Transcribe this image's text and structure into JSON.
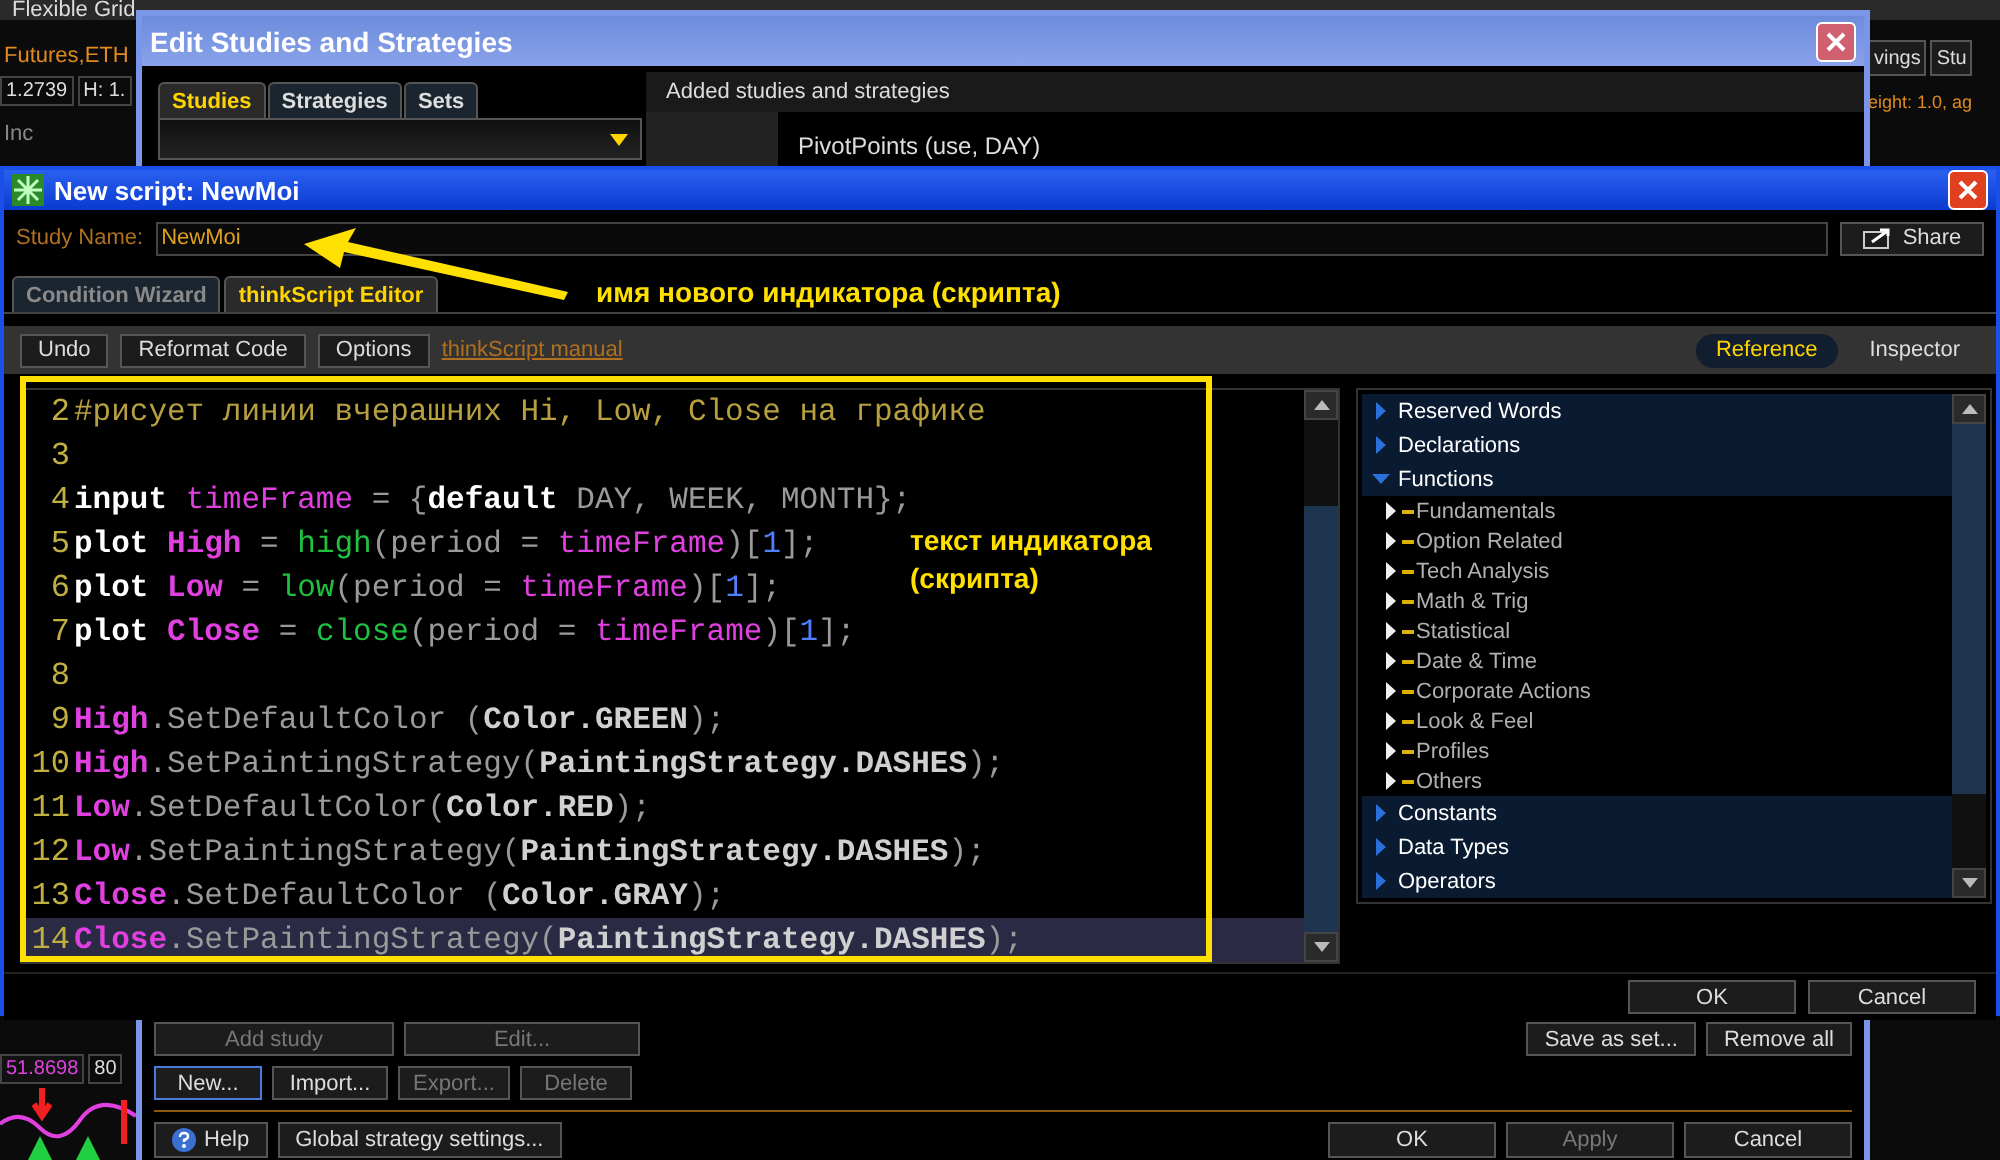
{
  "background": {
    "top_tab": "Flexible Grid",
    "symbol_text": "Futures,ETH",
    "price": "1.2739",
    "high": "H: 1.",
    "row_label": "Inc",
    "right_button": "vings",
    "study_button": "Stu",
    "right_info": "eight: 1.0, ag",
    "reading": "51.8698",
    "reading_2": "80"
  },
  "edit_studies": {
    "title": "Edit Studies and Strategies",
    "tabs": [
      {
        "label": "Studies",
        "selected": true
      },
      {
        "label": "Strategies",
        "selected": false
      },
      {
        "label": "Sets",
        "selected": false
      }
    ],
    "added_label": "Added studies and strategies",
    "added_item": "PivotPoints (use, DAY)",
    "row_1_left": [
      {
        "label": "Add study",
        "disabled": true
      },
      {
        "label": "Edit...",
        "disabled": true
      }
    ],
    "row_1_right": [
      {
        "label": "Save as set...",
        "disabled": false
      },
      {
        "label": "Remove all",
        "disabled": false
      }
    ],
    "row_2": [
      {
        "label": "New...",
        "disabled": false,
        "focused": true
      },
      {
        "label": "Import...",
        "disabled": false,
        "focused": false
      },
      {
        "label": "Export...",
        "disabled": true,
        "focused": false
      },
      {
        "label": "Delete",
        "disabled": true,
        "focused": false
      }
    ],
    "help": "Help",
    "global_settings": "Global strategy settings...",
    "dialog_buttons": [
      {
        "label": "OK",
        "disabled": false
      },
      {
        "label": "Apply",
        "disabled": true
      },
      {
        "label": "Cancel",
        "disabled": false
      }
    ]
  },
  "script_window": {
    "title": "New script: NewMoi",
    "study_name_label": "Study Name:",
    "study_name": "NewMoi",
    "share": "Share",
    "tabs": [
      {
        "label": "Condition Wizard",
        "selected": false
      },
      {
        "label": "thinkScript Editor",
        "selected": true
      }
    ],
    "toolbar": [
      "Undo",
      "Reformat Code",
      "Options"
    ],
    "manual_link": "thinkScript manual",
    "panel_tabs": [
      {
        "label": "Reference",
        "selected": true
      },
      {
        "label": "Inspector",
        "selected": false
      }
    ],
    "code_lines": [
      {
        "number": "2",
        "current": false,
        "tokens": [
          {
            "kind": "comment",
            "text": "#рисует линии вчерашних Hi, Low, Close на графике"
          }
        ]
      },
      {
        "number": "3",
        "current": false
      },
      {
        "number": "4",
        "current": false,
        "tokens": [
          {
            "kind": "keyword",
            "text": "input "
          },
          {
            "kind": "param",
            "text": "timeFrame"
          },
          {
            "kind": "plain",
            "text": " = {"
          },
          {
            "kind": "keyword",
            "text": "default"
          },
          {
            "kind": "plain",
            "text": " DAY, WEEK, MONTH};"
          }
        ]
      },
      {
        "number": "5",
        "current": false,
        "tokens": [
          {
            "kind": "keyword",
            "text": "plot "
          },
          {
            "kind": "name",
            "text": "High"
          },
          {
            "kind": "plain",
            "text": " = "
          },
          {
            "kind": "func",
            "text": "high"
          },
          {
            "kind": "plain",
            "text": "(period = "
          },
          {
            "kind": "param",
            "text": "timeFrame"
          },
          {
            "kind": "plain",
            "text": ")["
          },
          {
            "kind": "number",
            "text": "1"
          },
          {
            "kind": "plain",
            "text": "];"
          }
        ]
      },
      {
        "number": "6",
        "current": false,
        "tokens": [
          {
            "kind": "keyword",
            "text": "plot "
          },
          {
            "kind": "name",
            "text": "Low"
          },
          {
            "kind": "plain",
            "text": " = "
          },
          {
            "kind": "func",
            "text": "low"
          },
          {
            "kind": "plain",
            "text": "(period = "
          },
          {
            "kind": "param",
            "text": "timeFrame"
          },
          {
            "kind": "plain",
            "text": ")["
          },
          {
            "kind": "number",
            "text": "1"
          },
          {
            "kind": "plain",
            "text": "];"
          }
        ]
      },
      {
        "number": "7",
        "current": false,
        "tokens": [
          {
            "kind": "keyword",
            "text": "plot "
          },
          {
            "kind": "name",
            "text": "Close"
          },
          {
            "kind": "plain",
            "text": " = "
          },
          {
            "kind": "func",
            "text": "close"
          },
          {
            "kind": "plain",
            "text": "(period = "
          },
          {
            "kind": "param",
            "text": "timeFrame"
          },
          {
            "kind": "plain",
            "text": ")["
          },
          {
            "kind": "number",
            "text": "1"
          },
          {
            "kind": "plain",
            "text": "];"
          }
        ]
      },
      {
        "number": "8",
        "current": false
      },
      {
        "number": "9",
        "current": false,
        "tokens": [
          {
            "kind": "name",
            "text": "High"
          },
          {
            "kind": "plain",
            "text": ".SetDefaultColor ("
          },
          {
            "kind": "const",
            "text": "Color.GREEN"
          },
          {
            "kind": "plain",
            "text": ");"
          }
        ]
      },
      {
        "number": "10",
        "current": false,
        "tokens": [
          {
            "kind": "name",
            "text": "High"
          },
          {
            "kind": "plain",
            "text": ".SetPaintingStrategy("
          },
          {
            "kind": "const",
            "text": "PaintingStrategy.DASHES"
          },
          {
            "kind": "plain",
            "text": ");"
          }
        ]
      },
      {
        "number": "11",
        "current": false,
        "tokens": [
          {
            "kind": "name",
            "text": "Low"
          },
          {
            "kind": "plain",
            "text": ".SetDefaultColor("
          },
          {
            "kind": "const",
            "text": "Color.RED"
          },
          {
            "kind": "plain",
            "text": ");"
          }
        ]
      },
      {
        "number": "12",
        "current": false,
        "tokens": [
          {
            "kind": "name",
            "text": "Low"
          },
          {
            "kind": "plain",
            "text": ".SetPaintingStrategy("
          },
          {
            "kind": "const",
            "text": "PaintingStrategy.DASHES"
          },
          {
            "kind": "plain",
            "text": ");"
          }
        ]
      },
      {
        "number": "13",
        "current": false,
        "tokens": [
          {
            "kind": "name",
            "text": "Close"
          },
          {
            "kind": "plain",
            "text": ".SetDefaultColor ("
          },
          {
            "kind": "const",
            "text": "Color.GRAY"
          },
          {
            "kind": "plain",
            "text": ");"
          }
        ]
      },
      {
        "number": "14",
        "current": true,
        "tokens": [
          {
            "kind": "name",
            "text": "Close"
          },
          {
            "kind": "plain",
            "text": ".SetPaintingStrategy("
          },
          {
            "kind": "const",
            "text": "PaintingStrategy.DASHES"
          },
          {
            "kind": "plain",
            "text": ");"
          }
        ]
      }
    ],
    "reference": [
      {
        "label": "Reserved Words",
        "expanded": false
      },
      {
        "label": "Declarations",
        "expanded": false
      },
      {
        "label": "Functions",
        "expanded": true,
        "children": [
          {
            "label": "Fundamentals",
            "expanded": false
          },
          {
            "label": "Option Related",
            "expanded": false
          },
          {
            "label": "Tech Analysis",
            "expanded": false
          },
          {
            "label": "Math & Trig",
            "expanded": false
          },
          {
            "label": "Statistical",
            "expanded": false
          },
          {
            "label": "Date & Time",
            "expanded": false
          },
          {
            "label": "Corporate Actions",
            "expanded": false
          },
          {
            "label": "Look & Feel",
            "expanded": false
          },
          {
            "label": "Profiles",
            "expanded": false
          },
          {
            "label": "Others",
            "expanded": false
          }
        ]
      },
      {
        "label": "Constants",
        "expanded": false
      },
      {
        "label": "Data Types",
        "expanded": false
      },
      {
        "label": "Operators",
        "expanded": false
      }
    ],
    "buttons": [
      "OK",
      "Cancel"
    ]
  },
  "annotations": [
    {
      "text": "имя нового индикатора (скрипта)"
    },
    {
      "text": "текст индикатора (скрипта)"
    }
  ]
}
